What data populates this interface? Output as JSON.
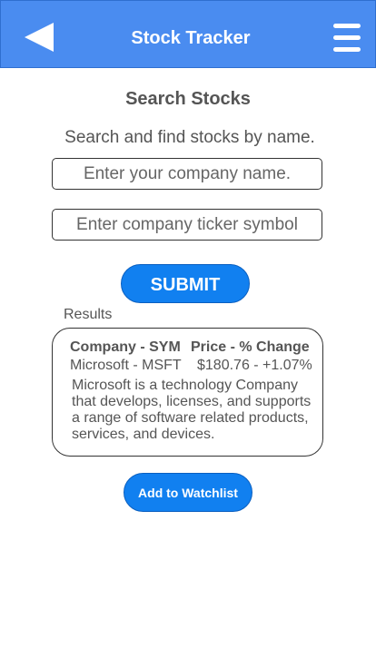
{
  "header": {
    "title": "Stock Tracker",
    "back_icon": "back-triangle-icon",
    "menu_icon": "hamburger-menu-icon",
    "color": "#4a8cf0"
  },
  "search": {
    "title": "Search Stocks",
    "subtitle": "Search and find stocks by name.",
    "company_placeholder": "Enter your company name.",
    "ticker_placeholder": "Enter company ticker symbol",
    "submit_label": "SUBMIT"
  },
  "results": {
    "label": "Results",
    "company_header": "Company - SYM",
    "price_header": "Price - % Change",
    "company_value": "Microsoft - MSFT",
    "price_value": "$180.76 - +1.07%",
    "description": "Microsoft is a technology Company that develops, licenses, and supports a range of software related products, services, and devices."
  },
  "watchlist": {
    "label": "Add to Watchlist"
  },
  "colors": {
    "accent": "#1180f0",
    "text": "#555555"
  }
}
